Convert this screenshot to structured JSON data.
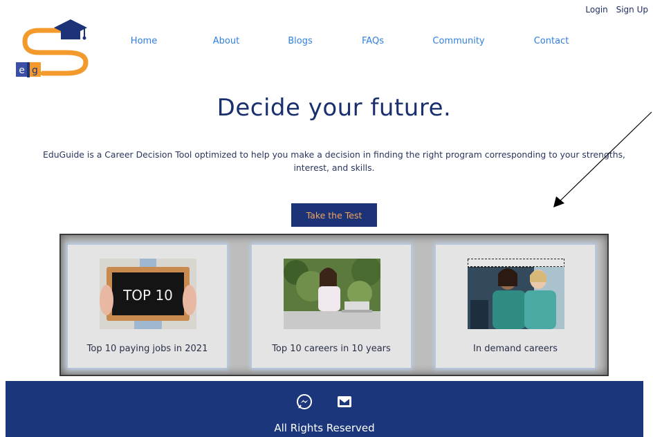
{
  "header": {
    "logo_text": "eg",
    "login_label": "Login",
    "signup_label": "Sign Up"
  },
  "nav": {
    "items": [
      {
        "label": "Home"
      },
      {
        "label": "About"
      },
      {
        "label": "Blogs"
      },
      {
        "label": "FAQs"
      },
      {
        "label": "Community"
      },
      {
        "label": "Contact"
      }
    ]
  },
  "hero": {
    "title": "Decide your future.",
    "description": "EduGuide is a Career Decision Tool optimized to help you make a decision in finding the right program corresponding to your strengths, interest, and skills.",
    "cta_label": "Take the Test"
  },
  "cards": [
    {
      "label": "Top 10 paying jobs in 2021",
      "image_text": "TOP 10"
    },
    {
      "label": "Top 10 careers in 10 years"
    },
    {
      "label": "In demand careers"
    }
  ],
  "footer": {
    "icons": [
      "messenger-icon",
      "mail-icon"
    ],
    "rights": "All Rights Reserved"
  },
  "colors": {
    "primary_navy": "#1b367a",
    "nav_link": "#2f7fe0",
    "cta_text": "#f2a45a",
    "logo_orange": "#f39a2c"
  }
}
